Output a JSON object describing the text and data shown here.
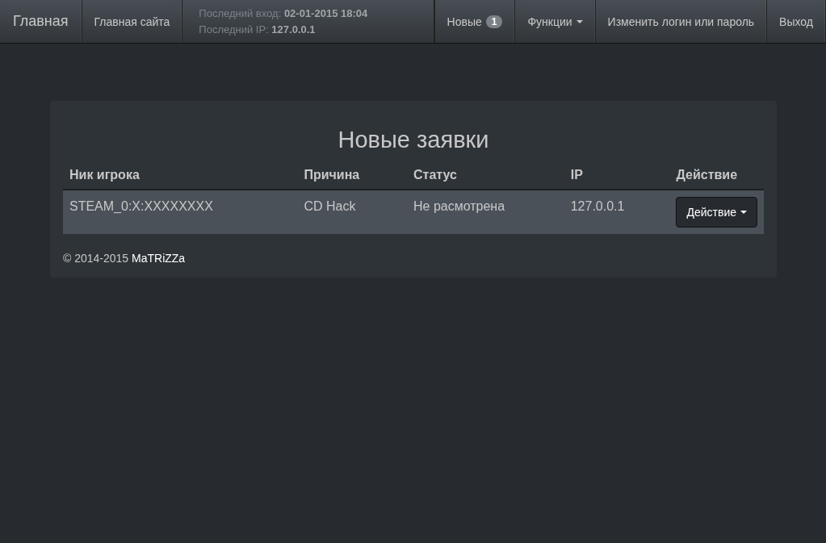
{
  "navbar": {
    "brand": "Главная",
    "left_links": [
      {
        "label": "Главная сайта",
        "kind": "link"
      }
    ],
    "login_info": [
      "Последний вход: **02-01-2015 18:04**",
      "Последний IP: **127.0.0.1**"
    ],
    "right_links": [
      {
        "label": "Новые",
        "kind": "badge",
        "badge": "1"
      },
      {
        "label": "Функции",
        "kind": "dropdown"
      },
      {
        "label": "Изменить логин или пароль",
        "kind": "link"
      },
      {
        "label": "Выход",
        "kind": "link"
      }
    ]
  },
  "panel": {
    "title": "Новые заявки",
    "table": {
      "columns": [
        "Ник игрока",
        "Причина",
        "Статус",
        "IP",
        "Действие"
      ],
      "rows": [
        {
          "cells": [
            "STEAM_0:X:XXXXXXXX",
            "CD Hack",
            "Не расмотрена",
            "127.0.0.1"
          ],
          "action": "Действие"
        }
      ]
    },
    "footer": {
      "text": "© 2014-2015 ",
      "link": "MaTRiZZa"
    }
  }
}
